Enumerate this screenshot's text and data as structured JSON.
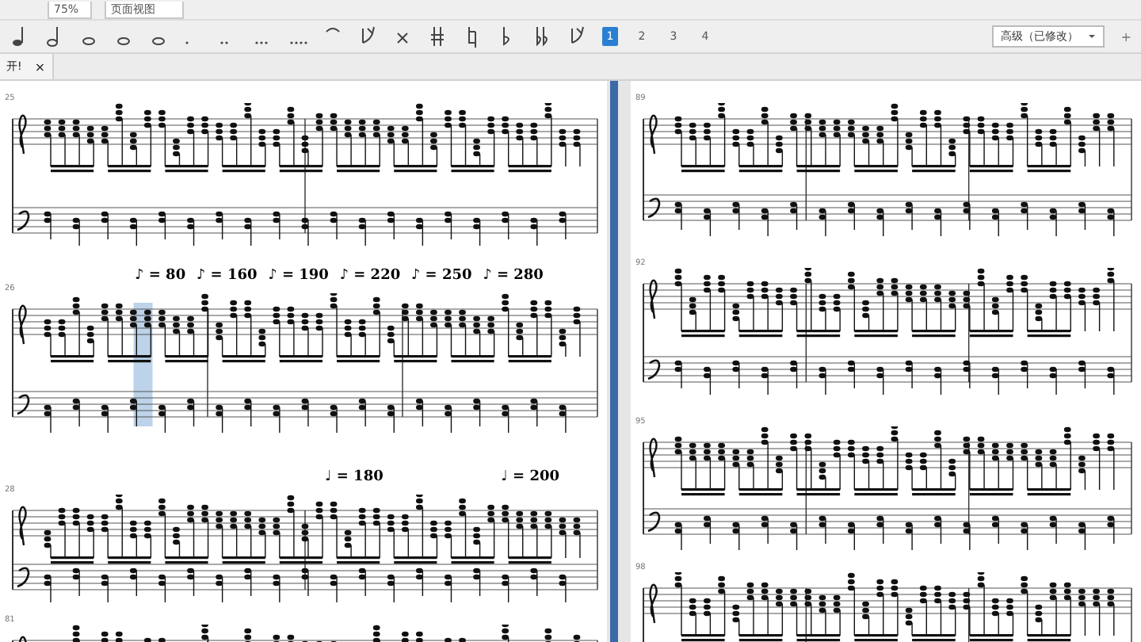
{
  "toolbar": {
    "zoom": "75%",
    "view_mode": "页面视图"
  },
  "voices": [
    {
      "label": "1",
      "selected": true
    },
    {
      "label": "2",
      "selected": false
    },
    {
      "label": "3",
      "selected": false
    },
    {
      "label": "4",
      "selected": false
    }
  ],
  "workspace": {
    "value": "高级（已修改）",
    "add": "+"
  },
  "tabs": [
    {
      "label": "开!",
      "close": "×",
      "selected": true
    }
  ],
  "left_page": {
    "systems": [
      {
        "measure_number": "25",
        "selected": false
      },
      {
        "measure_number": "26",
        "tempos": [
          "♪ = 80",
          "♪ = 160",
          "♪ = 190",
          "♪ = 220",
          "♪ = 250",
          "♪ = 280"
        ],
        "selected": true
      },
      {
        "measure_number": "28",
        "tempos": [
          "♩ = 180",
          "♩ = 200"
        ],
        "selected": false
      },
      {
        "measure_number": "81",
        "selected": false
      }
    ]
  },
  "right_page": {
    "systems": [
      {
        "measure_number": "89",
        "selected": false
      },
      {
        "measure_number": "92",
        "selected": false
      },
      {
        "measure_number": "95",
        "selected": false
      },
      {
        "measure_number": "98",
        "selected": false
      }
    ]
  }
}
